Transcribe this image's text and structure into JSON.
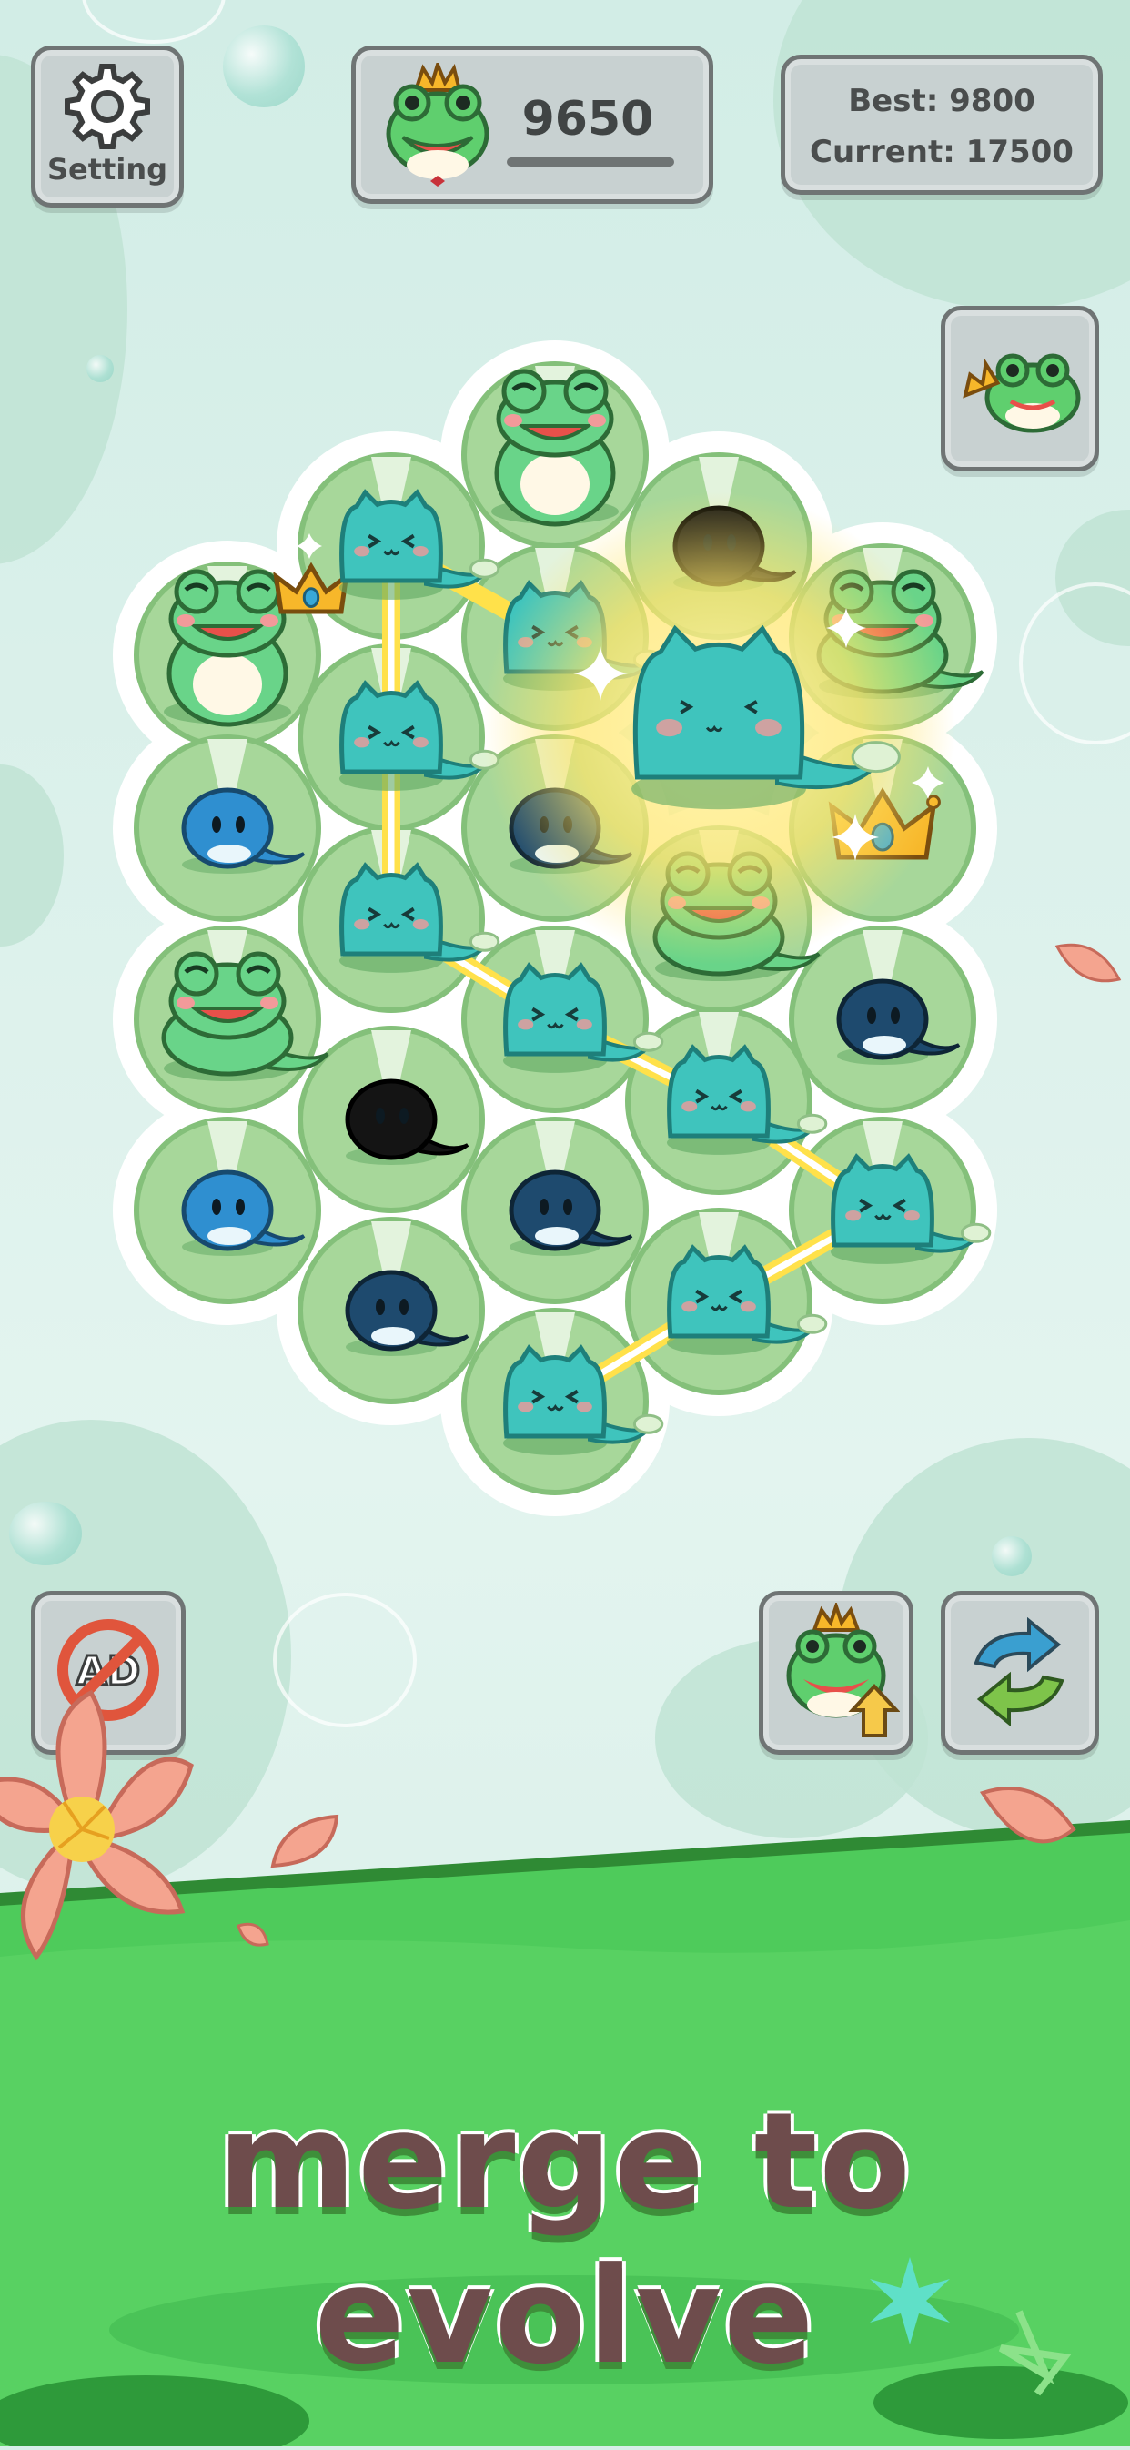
{
  "header": {
    "setting_label": "Setting",
    "score": "9650",
    "best_label": "Best: 9800",
    "current_label": "Current: 17500"
  },
  "tagline": "merge to evolve",
  "colors": {
    "background": "#d7efe9",
    "lily_pad": "#a7d79a",
    "tadpole_teal": "#3fc4bd",
    "frog_green": "#69d489",
    "merge_line": "#ffe14a",
    "banner_green": "#4ecb5b",
    "tagline_text": "#6e4c4c"
  },
  "icons": {
    "setting": "gear-icon",
    "score": "crowned-frog-icon",
    "king_frog": "frog-king-icon",
    "no_ads": "no-ads-icon",
    "upgrade": "frog-upgrade-icon",
    "shuffle": "shuffle-arrows-icon"
  },
  "board": {
    "cells": [
      {
        "id": "c1",
        "creature": "frog-sitting"
      },
      {
        "id": "c2",
        "creature": "frog-crown"
      },
      {
        "id": "c3",
        "creature": "teal-blob"
      },
      {
        "id": "c4",
        "creature": "black-tadpole"
      },
      {
        "id": "c5",
        "creature": "teal-blob"
      },
      {
        "id": "c6",
        "creature": "frog-lying"
      },
      {
        "id": "c7",
        "creature": "teal-blob"
      },
      {
        "id": "c8",
        "creature": "blue-tadpole"
      },
      {
        "id": "c9",
        "creature": "navy-tadpole"
      },
      {
        "id": "c10",
        "creature": "golden-crown"
      },
      {
        "id": "c11",
        "creature": "teal-blob"
      },
      {
        "id": "c12",
        "creature": "frog-lying"
      },
      {
        "id": "c13",
        "creature": "frog-lying"
      },
      {
        "id": "c14",
        "creature": "teal-blob"
      },
      {
        "id": "c15",
        "creature": "navy-tadpole"
      },
      {
        "id": "c16",
        "creature": "black-tadpole"
      },
      {
        "id": "c17",
        "creature": "teal-blob"
      },
      {
        "id": "c18",
        "creature": "blue-tadpole"
      },
      {
        "id": "c19",
        "creature": "navy-tadpole"
      },
      {
        "id": "c20",
        "creature": "teal-blob"
      },
      {
        "id": "c21",
        "creature": "navy-tadpole"
      },
      {
        "id": "c22",
        "creature": "teal-blob"
      },
      {
        "id": "c23",
        "creature": "teal-blob"
      }
    ],
    "merge_result": "big-teal-blob"
  }
}
